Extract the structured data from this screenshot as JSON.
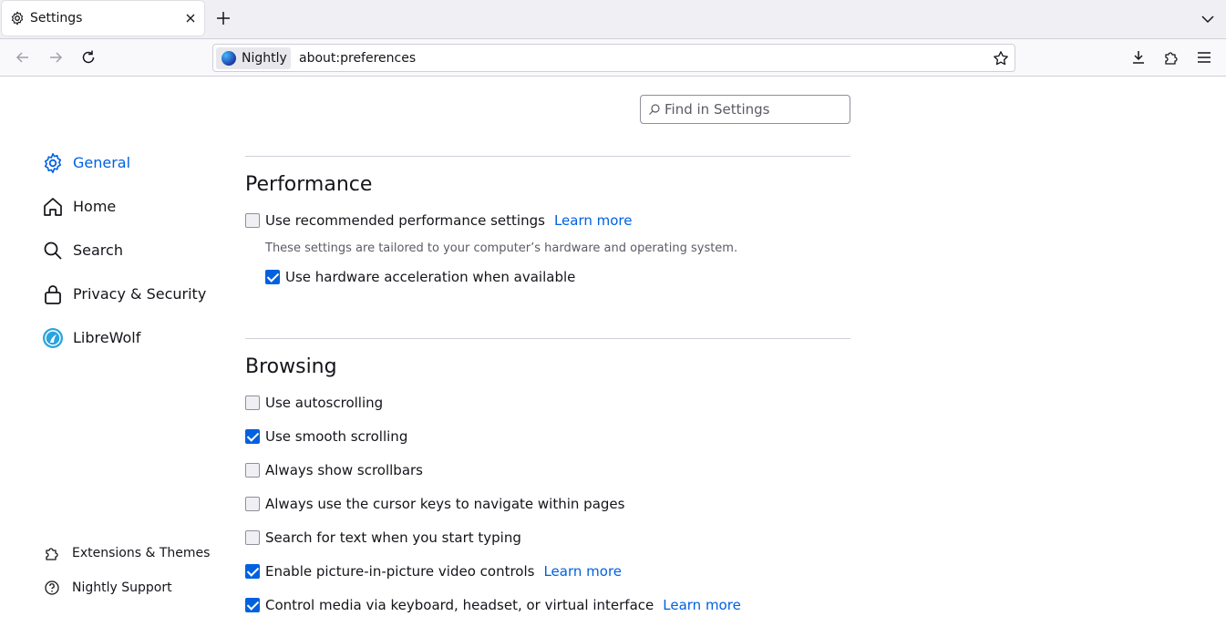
{
  "tab": {
    "title": "Settings"
  },
  "urlbar": {
    "identity_label": "Nightly",
    "url": "about:preferences"
  },
  "search": {
    "placeholder": "Find in Settings"
  },
  "sidebar": {
    "categories": [
      {
        "label": "General",
        "icon": "gear-icon",
        "selected": true
      },
      {
        "label": "Home",
        "icon": "home-icon"
      },
      {
        "label": "Search",
        "icon": "search-icon"
      },
      {
        "label": "Privacy & Security",
        "icon": "lock-icon"
      },
      {
        "label": "LibreWolf",
        "icon": "librewolf-icon"
      }
    ],
    "footer": [
      {
        "label": "Extensions & Themes",
        "icon": "puzzle-icon"
      },
      {
        "label": "Nightly Support",
        "icon": "help-icon"
      }
    ]
  },
  "performance": {
    "title": "Performance",
    "recommended": {
      "label": "Use recommended performance settings",
      "checked": false,
      "learn_more": "Learn more"
    },
    "description": "These settings are tailored to your computer’s hardware and operating system.",
    "hw_accel": {
      "label": "Use hardware acceleration when available",
      "checked": true
    }
  },
  "browsing": {
    "title": "Browsing",
    "options": [
      {
        "label": "Use autoscrolling",
        "checked": false
      },
      {
        "label": "Use smooth scrolling",
        "checked": true
      },
      {
        "label": "Always show scrollbars",
        "checked": false
      },
      {
        "label": "Always use the cursor keys to navigate within pages",
        "checked": false
      },
      {
        "label": "Search for text when you start typing",
        "checked": false
      },
      {
        "label": "Enable picture-in-picture video controls",
        "checked": true,
        "learn_more": "Learn more"
      },
      {
        "label": "Control media via keyboard, headset, or virtual interface",
        "checked": true,
        "learn_more": "Learn more"
      }
    ]
  },
  "colors": {
    "accent": "#0061e0",
    "text": "#15141a",
    "muted": "#5b5b66"
  }
}
